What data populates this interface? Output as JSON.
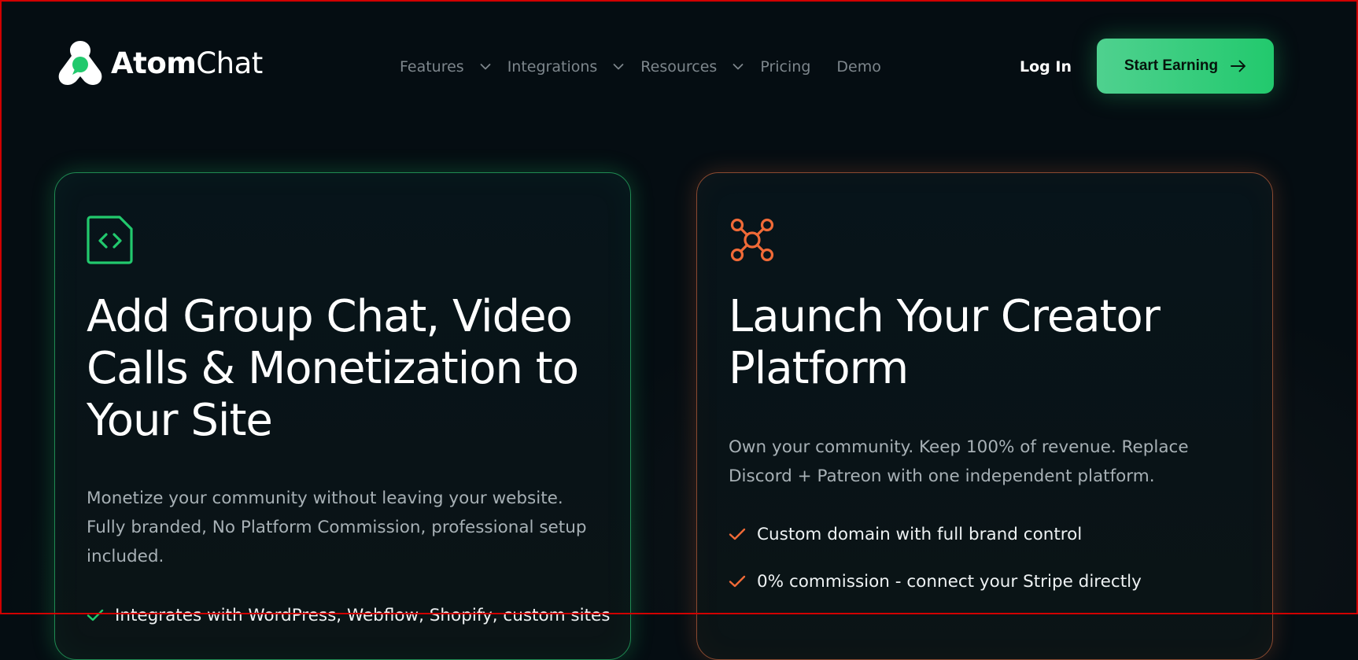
{
  "header": {
    "logo": {
      "bold": "Atom",
      "light": "Chat",
      "icon": "atomchat-logo-icon"
    },
    "nav": {
      "items": [
        {
          "label": "Features",
          "has_dropdown": true
        },
        {
          "label": "Integrations",
          "has_dropdown": true
        },
        {
          "label": "Resources",
          "has_dropdown": true
        },
        {
          "label": "Pricing",
          "has_dropdown": false
        },
        {
          "label": "Demo",
          "has_dropdown": false
        }
      ]
    },
    "login_label": "Log In",
    "cta_label": "Start Earning",
    "cta_icon": "arrow-right-icon"
  },
  "cards": [
    {
      "icon": "code-file-icon",
      "accent": "#22c96d",
      "title": "Add Group Chat, Video Calls & Monetization to Your Site",
      "description": "Monetize your community without leaving your website. Fully branded, No Platform Commission, professional setup included.",
      "features": [
        "Integrates with WordPress, Webflow, Shopify, custom sites"
      ]
    },
    {
      "icon": "network-nodes-icon",
      "accent": "#f06a37",
      "title": "Launch Your Creator Platform",
      "description": "Own your community. Keep 100% of revenue. Replace Discord + Patreon with one independent platform.",
      "features": [
        "Custom domain with full brand control",
        "0% commission - connect your Stripe directly"
      ]
    }
  ],
  "colors": {
    "background": "#050d12",
    "nav_text": "#7d868c",
    "cta_green": "#22c96d",
    "orange_accent": "#f06a37"
  }
}
